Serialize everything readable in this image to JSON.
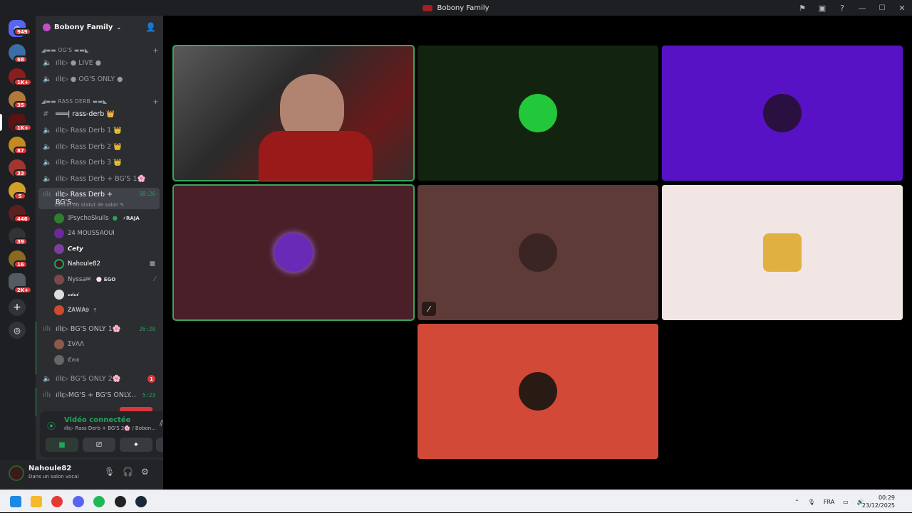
{
  "window": {
    "title": "Bobony Family"
  },
  "guild": {
    "name": "Bobony Family"
  },
  "server_badges": [
    "949",
    "68",
    "1K+",
    "35",
    "1K+",
    "87",
    "33",
    "5",
    "446",
    "39",
    "16",
    "2K+"
  ],
  "categories": [
    {
      "name": "◢▬▬ OG'S ▬▬◣"
    },
    {
      "name": "◢▬▬ RASS DERB ▬▬◣"
    }
  ],
  "channels": [
    {
      "label": "ıllı▷ ● LIVE ●",
      "type": "voice"
    },
    {
      "label": "ıllı▷ ● OG'S ONLY ●",
      "type": "voice"
    },
    {
      "label": "═══| rass-derb 👑",
      "type": "text"
    },
    {
      "label": "ıllı▷ Rass Derb 1 👑",
      "type": "voice"
    },
    {
      "label": "ıllı▷ Rass Derb 2 👑",
      "type": "voice"
    },
    {
      "label": "ıllı▷ Rass Derb 3 👑",
      "type": "voice"
    },
    {
      "label": "ıllı▷ Rass Derb + BG'S 1🌸",
      "type": "voice"
    },
    {
      "label": "ıllı▷ Rass Derb + BG'S...",
      "type": "voice",
      "timer": "58:26",
      "status": "Définir un statut de salon ✎"
    },
    {
      "label": "ıllı▷ BG'S ONLY 1🌸",
      "type": "voice",
      "timer": "26:20"
    },
    {
      "label": "ıllı▷ BG'S ONLY 2🌸",
      "type": "voice",
      "unread": "1"
    },
    {
      "label": "ıllı▷MG'S + BG'S ONLY...",
      "type": "voice",
      "timer": "5:23"
    }
  ],
  "voice_users": [
    {
      "name": "𝕀PsychoSkulls",
      "tag": "⚡RAJA"
    },
    {
      "name": "24 MOUSSAOUI",
      "tag": ""
    },
    {
      "name": "𝘾𝙚𝙩𝙮",
      "tag": ""
    },
    {
      "name": "Nahoule82",
      "tag": ""
    },
    {
      "name": "Nyssa✉",
      "tag": "💮 EGO"
    },
    {
      "name": "𝓿𝓲𝓿𝓲",
      "tag": ""
    },
    {
      "name": "𝐙𝐀𝐖𝐀𝟗",
      "tag": ""
    }
  ],
  "voice_users_bg1": [
    {
      "name": "ΣVΛΛ"
    },
    {
      "name": "ℭ𝔬𝔠𝔞"
    }
  ],
  "voice_panel": {
    "title": "Vidéo connectée",
    "sub": "ıllı▷ Rass Derb + BG'S 2🌸 / Bobon..."
  },
  "user": {
    "name": "Nahoule82",
    "status": "Dans un salon vocal"
  },
  "taskbar": {
    "lang": "FRA",
    "time": "00:29",
    "date": "23/12/2025"
  },
  "colors": {
    "accent_green": "#23a55a",
    "unread_red": "#da373c",
    "rail": "#1e1f22",
    "sidebar": "#2b2d31"
  },
  "icons": [
    "discord-home-icon",
    "add-server-icon",
    "discover-icon",
    "inbox-icon",
    "video-icon",
    "screen-share-icon",
    "activities-icon",
    "soundboard-icon",
    "mic-icon",
    "headphones-icon",
    "settings-icon",
    "disconnect-icon",
    "noise-suppression-icon"
  ]
}
